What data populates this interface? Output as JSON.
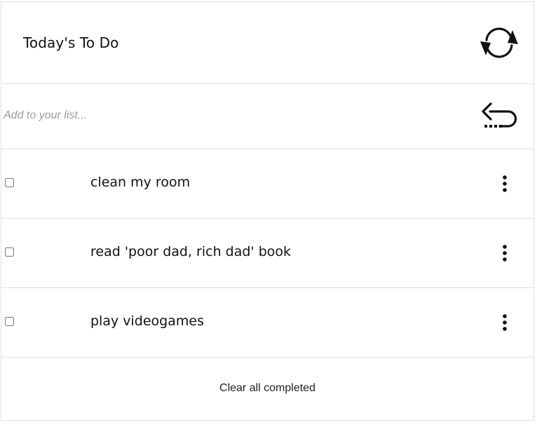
{
  "header": {
    "title": "Today's To Do",
    "refresh_icon": "refresh-icon"
  },
  "add_item": {
    "placeholder": "Add to your list...",
    "value": "",
    "enter_icon": "enter-return-icon"
  },
  "todos": [
    {
      "text": "clean my room",
      "completed": false,
      "menu_icon": "kebab-menu-icon"
    },
    {
      "text": "read 'poor dad, rich dad' book",
      "completed": false,
      "menu_icon": "kebab-menu-icon"
    },
    {
      "text": "play videogames",
      "completed": false,
      "menu_icon": "kebab-menu-icon"
    }
  ],
  "footer": {
    "clear_label": "Clear all completed"
  },
  "colors": {
    "border": "#e0e0e0",
    "text": "#111111",
    "placeholder": "#9a9a9a"
  }
}
